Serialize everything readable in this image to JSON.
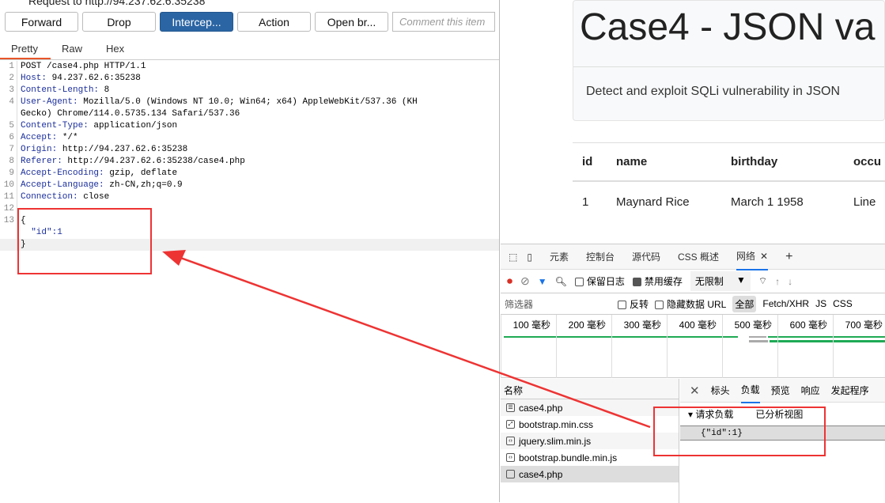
{
  "burp": {
    "title": "Request to http://94.237.62.6:35238",
    "buttons": [
      "Forward",
      "Drop",
      "Intercep...",
      "Action",
      "Open br..."
    ],
    "comment_placeholder": "Comment this item",
    "tabs": [
      "Pretty",
      "Raw",
      "Hex"
    ],
    "lines": [
      {
        "n": "1",
        "k": "",
        "v": "POST /case4.php HTTP/1.1"
      },
      {
        "n": "2",
        "k": "Host:",
        "v": " 94.237.62.6:35238"
      },
      {
        "n": "3",
        "k": "Content-Length:",
        "v": " 8"
      },
      {
        "n": "4",
        "k": "User-Agent:",
        "v": " Mozilla/5.0 (Windows NT 10.0; Win64; x64) AppleWebKit/537.36 (KH"
      },
      {
        "n": "",
        "k": "",
        "v": "Gecko) Chrome/114.0.5735.134 Safari/537.36"
      },
      {
        "n": "5",
        "k": "Content-Type:",
        "v": " application/json"
      },
      {
        "n": "6",
        "k": "Accept:",
        "v": " */*"
      },
      {
        "n": "7",
        "k": "Origin:",
        "v": " http://94.237.62.6:35238"
      },
      {
        "n": "8",
        "k": "Referer:",
        "v": " http://94.237.62.6:35238/case4.php"
      },
      {
        "n": "9",
        "k": "Accept-Encoding:",
        "v": " gzip, deflate"
      },
      {
        "n": "10",
        "k": "Accept-Language:",
        "v": " zh-CN,zh;q=0.9"
      },
      {
        "n": "11",
        "k": "Connection:",
        "v": " close"
      },
      {
        "n": "12",
        "k": "",
        "v": ""
      },
      {
        "n": "13",
        "k": "",
        "v": "{"
      },
      {
        "n": "",
        "k": "",
        "v": "  \"id\":1"
      },
      {
        "n": "",
        "k": "",
        "v": "}"
      }
    ]
  },
  "page": {
    "title": "Case4 - JSON va",
    "lead": "Detect and exploit SQLi vulnerability in JSON",
    "headers": [
      "id",
      "name",
      "birthday",
      "occu"
    ],
    "row": [
      "1",
      "Maynard Rice",
      "March 1 1958",
      "Line"
    ]
  },
  "devtools": {
    "tabs": [
      "元素",
      "控制台",
      "源代码",
      "CSS 概述",
      "网络"
    ],
    "preserve_log": "保留日志",
    "disable_cache": "禁用缓存",
    "throttle": "无限制",
    "filter_placeholder": "筛选器",
    "invert": "反转",
    "hide_data_url": "隐藏数据 URL",
    "types": [
      "全部",
      "Fetch/XHR",
      "JS",
      "CSS"
    ],
    "ticks": [
      "100 毫秒",
      "200 毫秒",
      "300 毫秒",
      "400 毫秒",
      "500 毫秒",
      "600 毫秒",
      "700 毫秒"
    ],
    "name_header": "名称",
    "requests": [
      "case4.php",
      "bootstrap.min.css",
      "jquery.slim.min.js",
      "bootstrap.bundle.min.js",
      "case4.php"
    ],
    "detail_tabs": [
      "标头",
      "负载",
      "预览",
      "响应",
      "发起程序"
    ],
    "payload_title": "请求负载",
    "parsed_view": "已分析视图",
    "payload": "{\"id\":1}"
  },
  "colors": {
    "accent": "#2b65a4",
    "annotation": "#e33333",
    "tab_underline": "#e8562a"
  }
}
